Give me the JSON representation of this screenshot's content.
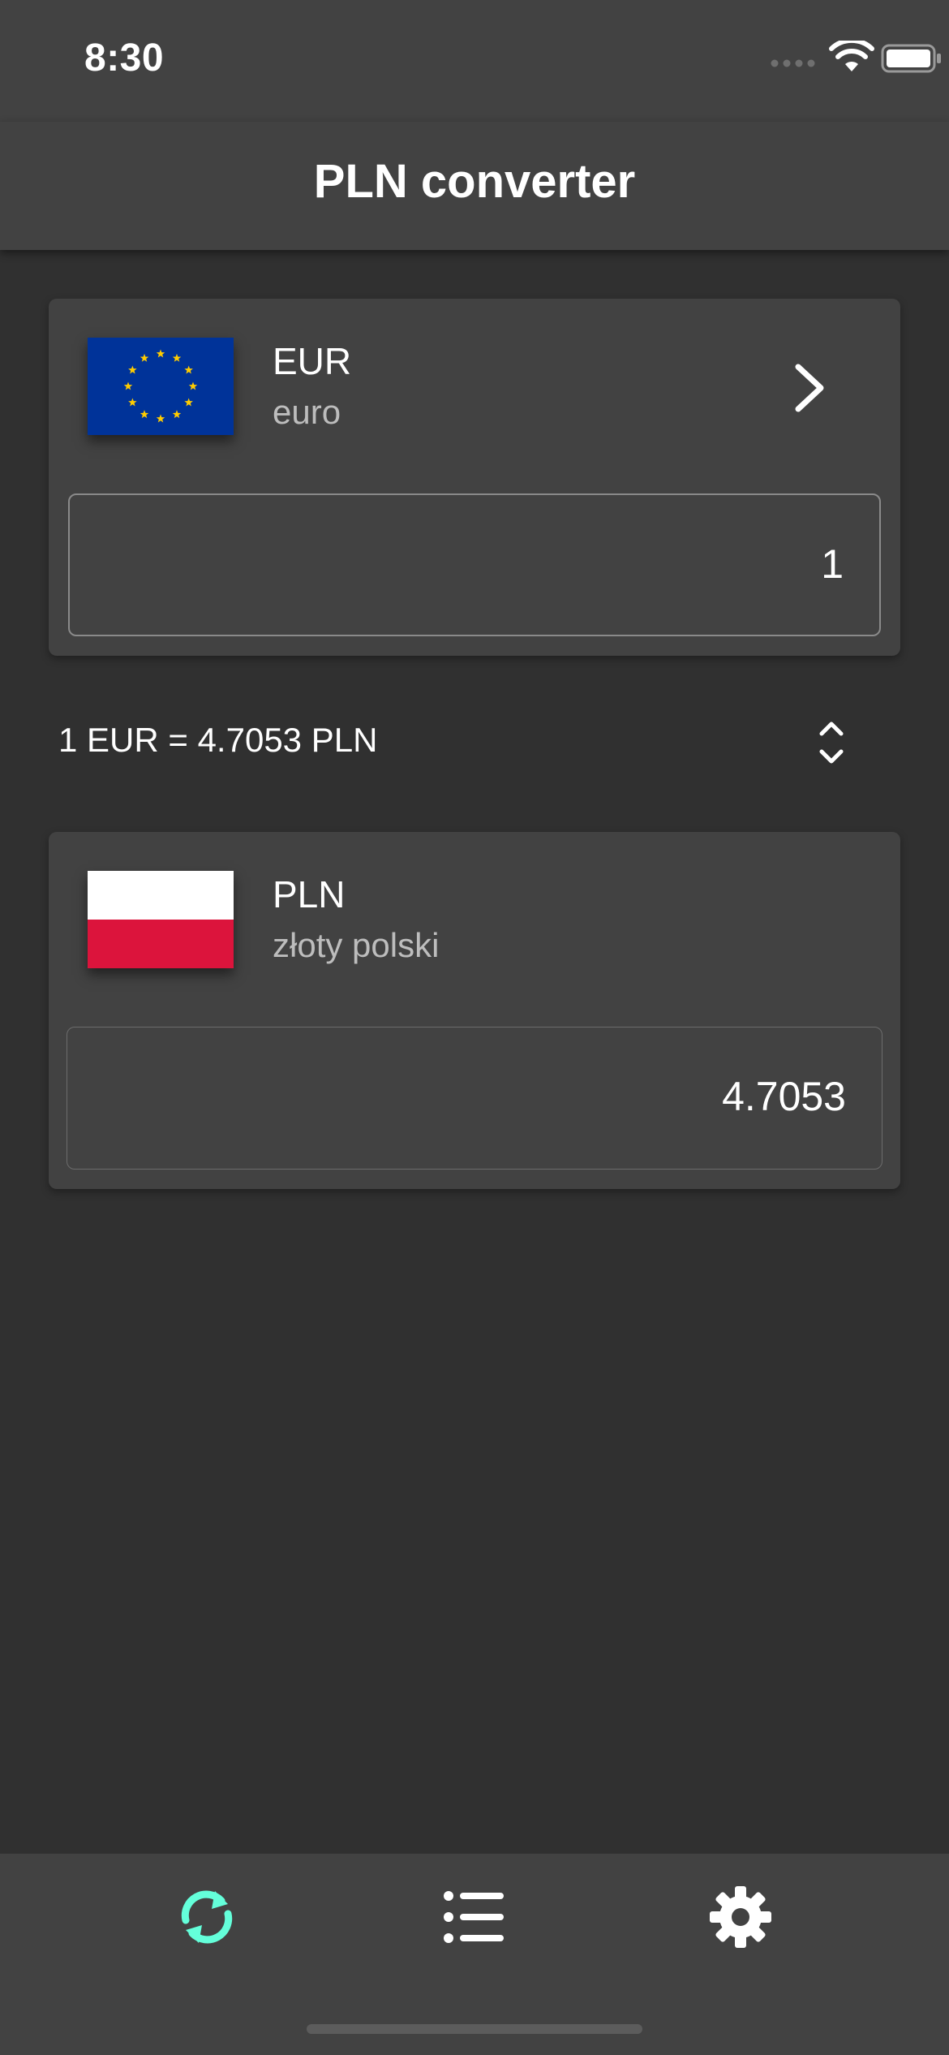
{
  "status_bar": {
    "time": "8:30",
    "icons": [
      "signal-icon",
      "wifi-icon",
      "battery-icon"
    ]
  },
  "app_bar": {
    "title": "PLN converter"
  },
  "from_currency": {
    "code": "EUR",
    "name": "euro",
    "flag": "eu-flag-icon",
    "amount": "1",
    "action_icon": "chevron-right-icon"
  },
  "rate": {
    "text": "1 EUR = 4.7053 PLN",
    "swap_icon": "swap-vertical-icon"
  },
  "to_currency": {
    "code": "PLN",
    "name": "złoty polski",
    "flag": "poland-flag-icon",
    "amount": "4.7053"
  },
  "bottom_nav": {
    "items": [
      {
        "icon": "refresh-icon",
        "active": true
      },
      {
        "icon": "list-icon",
        "active": false
      },
      {
        "icon": "gear-icon",
        "active": false
      }
    ],
    "active_color": "#64FFDA",
    "inactive_color": "#FFFFFF"
  },
  "colors": {
    "background": "#303030",
    "surface": "#424242",
    "accent": "#64FFDA",
    "eu_blue": "#003399",
    "eu_gold": "#FFCC00",
    "pl_red": "#DC143C"
  }
}
